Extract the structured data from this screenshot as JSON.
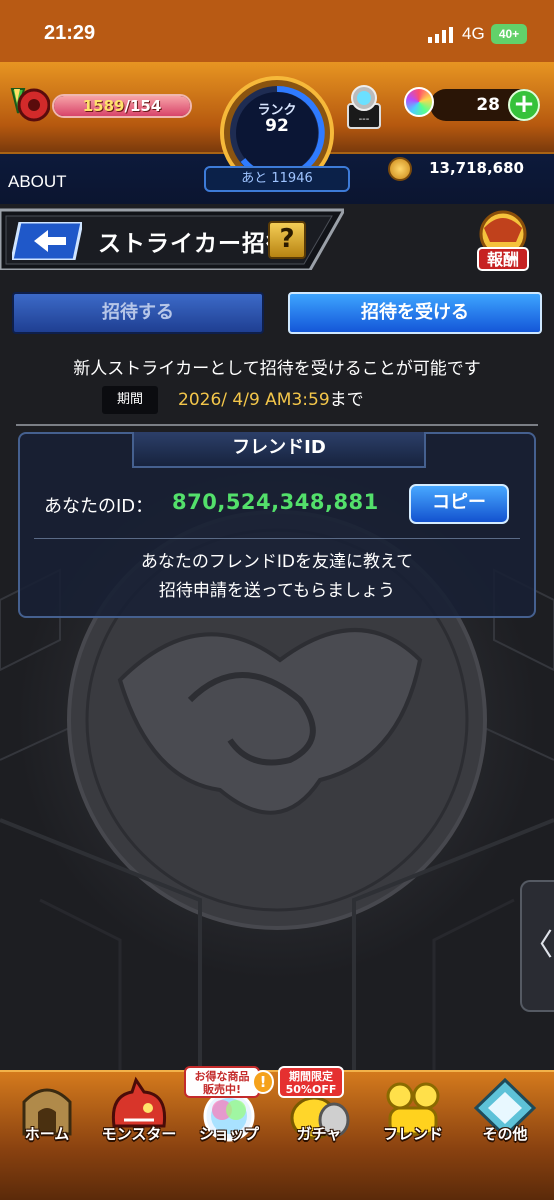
{
  "status_bar": {
    "time": "21:29",
    "network": "4G",
    "battery": "40+"
  },
  "header": {
    "stamina_current": "1589",
    "stamina_max": "/154",
    "stamina_fill_percent": 100,
    "rank_label": "ランク",
    "rank_value": "92",
    "exp_remaining": "あと 11946",
    "luck_label": "---",
    "orb_count": "28",
    "about_label": "ABOUT",
    "coin_count": "13,718,680"
  },
  "title_bar": {
    "title": "ストライカー招待",
    "help_label": "?",
    "reward_label": "報酬"
  },
  "tabs": [
    {
      "label": "招待する",
      "active": false
    },
    {
      "label": "招待を受ける",
      "active": true
    }
  ],
  "invite": {
    "notice": "新人ストライカーとして招待を受けることが可能です",
    "period_label": "期間",
    "period_value": "2026/ 4/9 AM3:59",
    "period_suffix": "まで"
  },
  "friend_panel": {
    "header": "フレンドID",
    "id_label": "あなたのID：",
    "id_value": "870,524,348,881",
    "copy_label": "コピー",
    "instruction_line1": "あなたのフレンドIDを友達に教えて",
    "instruction_line2": "招待申請を送ってもらましょう"
  },
  "side_tab": {
    "label": "〈"
  },
  "bottom_nav": {
    "items": [
      {
        "label": "ホーム",
        "icon": "home-icon"
      },
      {
        "label": "モンスター",
        "icon": "monster-icon"
      },
      {
        "label": "ショップ",
        "icon": "shop-icon"
      },
      {
        "label": "ガチャ",
        "icon": "gacha-icon"
      },
      {
        "label": "フレンド",
        "icon": "friend-icon"
      },
      {
        "label": "その他",
        "icon": "other-icon"
      }
    ],
    "shop_badge_line1": "お得な商品",
    "shop_badge_line2": "販売中!",
    "gacha_badge_line1": "期間限定",
    "gacha_badge_line2": "50%OFF",
    "alert_label": "!"
  },
  "colors": {
    "header_orange": "#e79522",
    "header_navy": "#0d1a3b",
    "id_green": "#53e06b",
    "period_gold": "#f3c64a",
    "active_tab_blue": "#1457d8"
  }
}
